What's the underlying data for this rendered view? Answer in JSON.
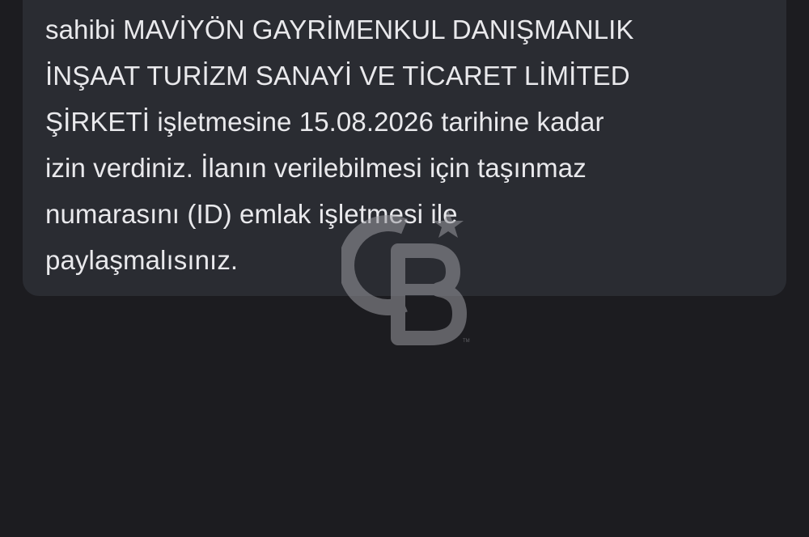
{
  "message": {
    "lines": [
      "sahibi MAVİYÖN GAYRİMENKUL DANIŞMANLIK",
      "İNŞAAT TURİZM SANAYİ VE TİCARET LİMİTED",
      "ŞİRKETİ işletmesine 15.08.2026 tarihine kadar",
      "izin verdiniz. İlanın verilebilmesi için taşınmaz",
      "numarasını (ID) emlak işletmesi ile",
      "paylaşmalısınız."
    ]
  },
  "watermark": {
    "text": "CB",
    "icon": "coldwell-banker-logo-icon",
    "color": "#8a8a90"
  },
  "colors": {
    "background": "#1c1c20",
    "card": "#2a2c32",
    "text": "#e9e9ec"
  }
}
